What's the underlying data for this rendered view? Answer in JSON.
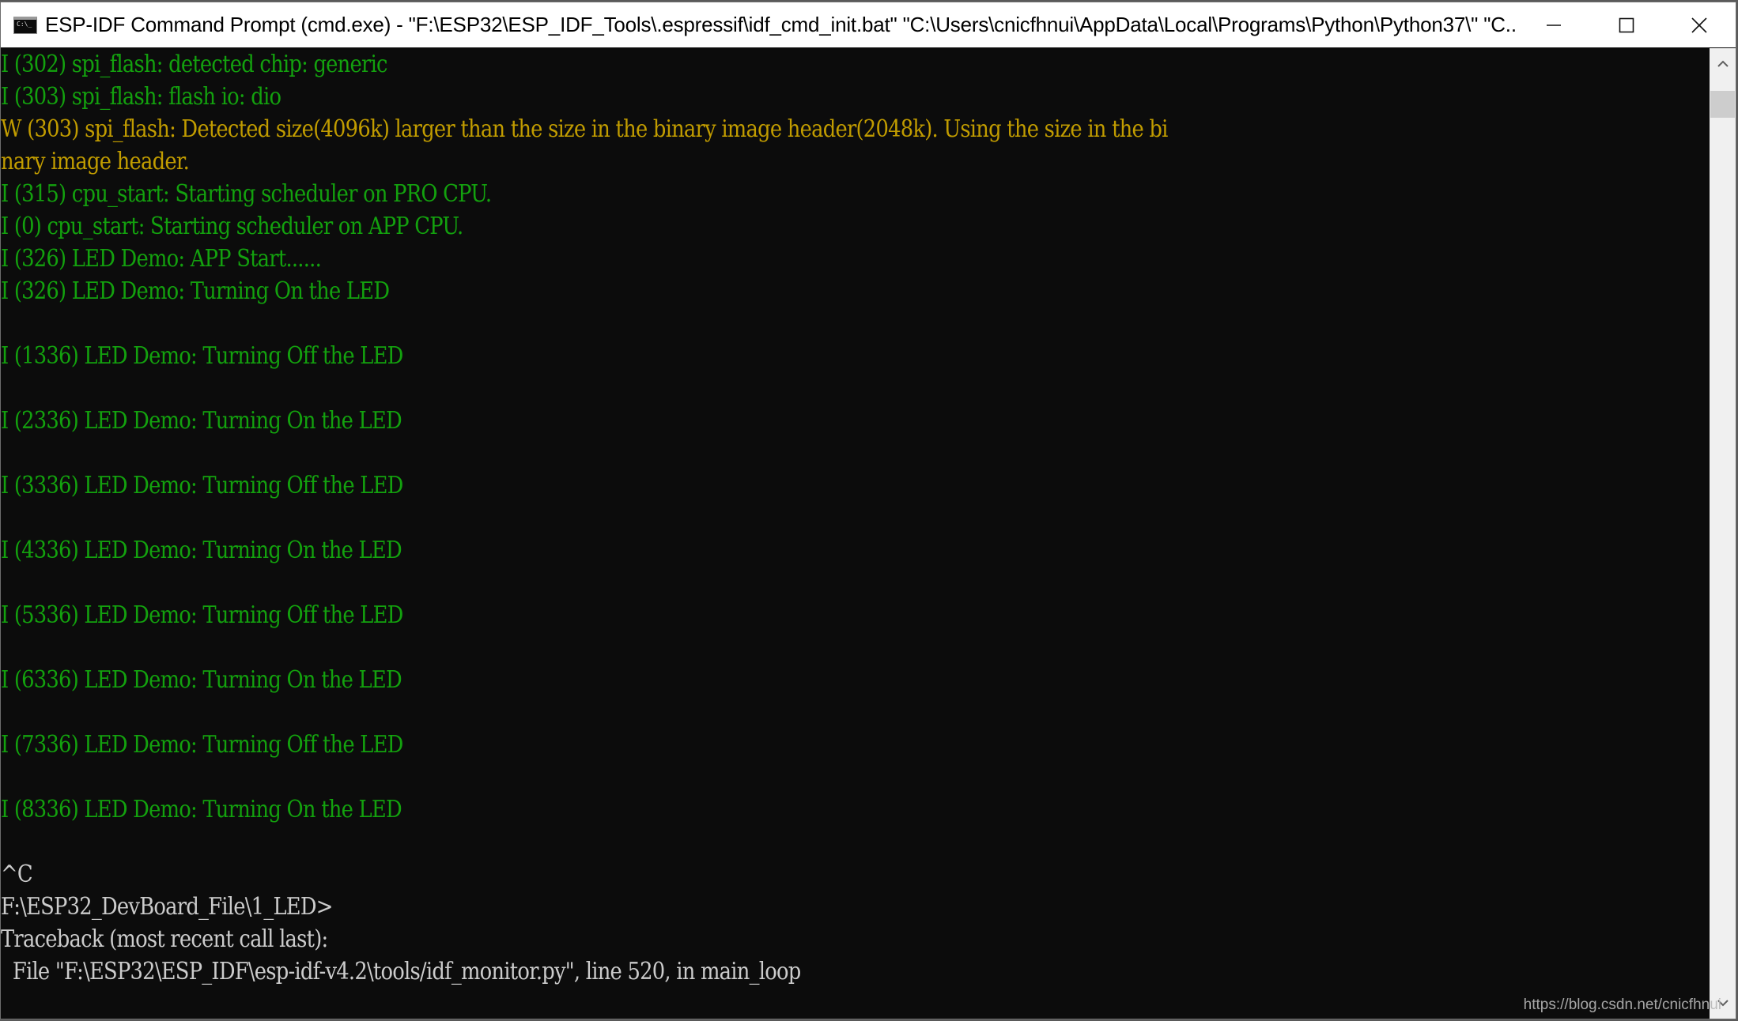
{
  "window": {
    "title": "ESP-IDF Command Prompt (cmd.exe) - \"F:\\ESP32\\ESP_IDF_Tools\\.espressif\\idf_cmd_init.bat\"  \"C:\\Users\\cnicfhnui\\AppData\\Local\\Programs\\Python\\Python37\\\" \"C...",
    "app_icon_text": "C:\\_",
    "controls": {
      "minimize": "minimize",
      "maximize": "maximize",
      "close": "close"
    }
  },
  "colors": {
    "background": "#0c0c0c",
    "info": "#13a10e",
    "warning": "#c19c00",
    "default": "#cccccc"
  },
  "terminal": {
    "lines": [
      {
        "text": "I (302) spi_flash: detected chip: generic",
        "level": "green"
      },
      {
        "text": "I (303) spi_flash: flash io: dio",
        "level": "green"
      },
      {
        "text": "W (303) spi_flash: Detected size(4096k) larger than the size in the binary image header(2048k). Using the size in the bi",
        "level": "yellow"
      },
      {
        "text": "nary image header.",
        "level": "yellow"
      },
      {
        "text": "I (315) cpu_start: Starting scheduler on PRO CPU.",
        "level": "green"
      },
      {
        "text": "I (0) cpu_start: Starting scheduler on APP CPU.",
        "level": "green"
      },
      {
        "text": "I (326) LED Demo: APP Start......",
        "level": "green"
      },
      {
        "text": "I (326) LED Demo: Turning On the LED",
        "level": "green"
      },
      {
        "text": "",
        "level": "green"
      },
      {
        "text": "I (1336) LED Demo: Turning Off the LED",
        "level": "green"
      },
      {
        "text": "",
        "level": "green"
      },
      {
        "text": "I (2336) LED Demo: Turning On the LED",
        "level": "green"
      },
      {
        "text": "",
        "level": "green"
      },
      {
        "text": "I (3336) LED Demo: Turning Off the LED",
        "level": "green"
      },
      {
        "text": "",
        "level": "green"
      },
      {
        "text": "I (4336) LED Demo: Turning On the LED",
        "level": "green"
      },
      {
        "text": "",
        "level": "green"
      },
      {
        "text": "I (5336) LED Demo: Turning Off the LED",
        "level": "green"
      },
      {
        "text": "",
        "level": "green"
      },
      {
        "text": "I (6336) LED Demo: Turning On the LED",
        "level": "green"
      },
      {
        "text": "",
        "level": "green"
      },
      {
        "text": "I (7336) LED Demo: Turning Off the LED",
        "level": "green"
      },
      {
        "text": "",
        "level": "green"
      },
      {
        "text": "I (8336) LED Demo: Turning On the LED",
        "level": "green"
      },
      {
        "text": "",
        "level": "gray"
      },
      {
        "text": "^C",
        "level": "gray"
      },
      {
        "text": "F:\\ESP32_DevBoard_File\\1_LED>",
        "level": "gray"
      },
      {
        "text": "Traceback (most recent call last):",
        "level": "gray"
      },
      {
        "text": "  File \"F:\\ESP32\\ESP_IDF\\esp-idf-v4.2\\tools/idf_monitor.py\", line 520, in main_loop",
        "level": "gray"
      }
    ]
  },
  "watermark": "https://blog.csdn.net/cnicfhnui"
}
